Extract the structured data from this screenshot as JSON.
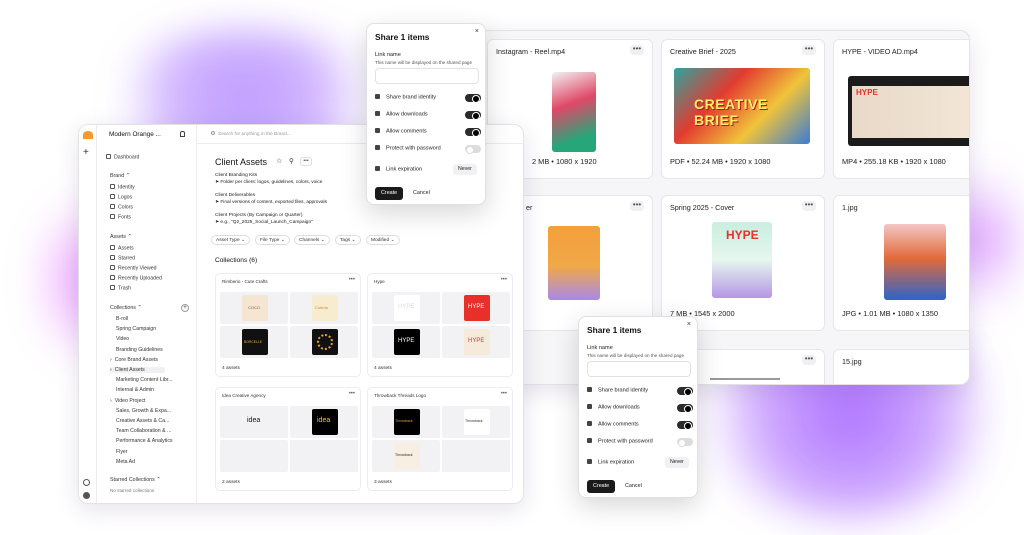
{
  "gallery": {
    "cards": [
      {
        "title": "Instagram - Reel.mp4",
        "meta": "2 MB • 1080 x 1920"
      },
      {
        "title": "Creative Brief - 2025",
        "meta": "PDF • 52.24 MB • 1920 x 1080",
        "thumb_text": "CREATIVE BRIEF"
      },
      {
        "title": "HYPE - VIDEO AD.mp4",
        "meta": "MP4 • 255.18 KB • 1920 x 1080",
        "thumb_text": "HYPE"
      },
      {
        "title": "er",
        "meta": ""
      },
      {
        "title": "Spring 2025 - Cover",
        "meta": "7 MB • 1545 x 2000",
        "thumb_text": "HYPE"
      },
      {
        "title": "1.jpg",
        "meta": "JPG • 1.01 MB • 1080 x 1350"
      },
      {
        "title": "15.jpg",
        "meta": ""
      }
    ],
    "more_label": "•••"
  },
  "sidebar": {
    "workspace": "Modern Orange ...",
    "dashboard": "Dashboard",
    "brand_header": "Brand",
    "brand_items": [
      "Identity",
      "Logos",
      "Colors",
      "Fonts"
    ],
    "assets_header": "Assets",
    "asset_items": [
      "Assets",
      "Starred",
      "Recently Viewed",
      "Recently Uploaded",
      "Trash"
    ],
    "collections_header": "Collections",
    "collection_items": [
      "B-roll",
      "Spring Campaign",
      "Video",
      "Branding Guidelines",
      "Core Brand Assets",
      "Client Assets",
      "Marketing Content Libr...",
      "Internal & Admin",
      "Video Project",
      "Sales, Growth & Expa...",
      "Creative Assets & Ca...",
      "Team Collaboration & ...",
      "Performance & Analytics",
      "Flyer",
      "Meta Ad"
    ],
    "starred_header": "Starred Collections",
    "starred_empty": "No starred collections"
  },
  "main": {
    "search_placeholder": "Search for anything in the Brand...",
    "title": "Client Assets",
    "description": [
      {
        "heading": "Client Branding Kits",
        "detail": "➤ Folder per client: logos, guidelines, colors, voice"
      },
      {
        "heading": "Client Deliverables",
        "detail": "➤ Final versions of content, exported files, approvals"
      },
      {
        "heading": "Client Projects (By Campaign or Quarter)",
        "detail": "➤ e.g., \"Q2_2025_Social_Launch_Campaign\""
      }
    ],
    "filters": [
      "Asset Type",
      "File Type",
      "Channels",
      "Tags",
      "Modified"
    ],
    "collections_heading": "Collections (6)",
    "collections": [
      {
        "title": "Rimberio - Cute Crafts",
        "footer": "4 assets",
        "images": [
          "COCO",
          "Cuteria",
          "BORCELLE",
          "badge"
        ]
      },
      {
        "title": "Hype",
        "footer": "4 assets",
        "images": [
          "HYPE",
          "HYPE",
          "HYPE",
          "HYPE"
        ]
      },
      {
        "title": "Idea Creative Agency",
        "footer": "2 assets",
        "images": [
          "idea",
          "idea"
        ]
      },
      {
        "title": "Throwback Threads Logo",
        "footer": "3 assets",
        "images": [
          "Throwback",
          "Throwback",
          "Throwback"
        ]
      }
    ]
  },
  "share_dialog": {
    "title": "Share 1 items",
    "link_name_label": "Link name",
    "link_name_help": "This name will be displayed on the shared page",
    "options": [
      {
        "label": "Share brand identity",
        "enabled": true
      },
      {
        "label": "Allow downloads",
        "enabled": true
      },
      {
        "label": "Allow comments",
        "enabled": true
      },
      {
        "label": "Protect with password",
        "enabled": false
      }
    ],
    "expiration_label": "Link expiration",
    "expiration_value": "Never",
    "create_label": "Create",
    "cancel_label": "Cancel",
    "close_glyph": "×"
  },
  "colors": {
    "accent": "#1a1a1a",
    "hype_red": "#e8302a",
    "brief_red": "#c8231c",
    "orange": "#f4a03a",
    "splash_purple": "#9c6bff"
  }
}
